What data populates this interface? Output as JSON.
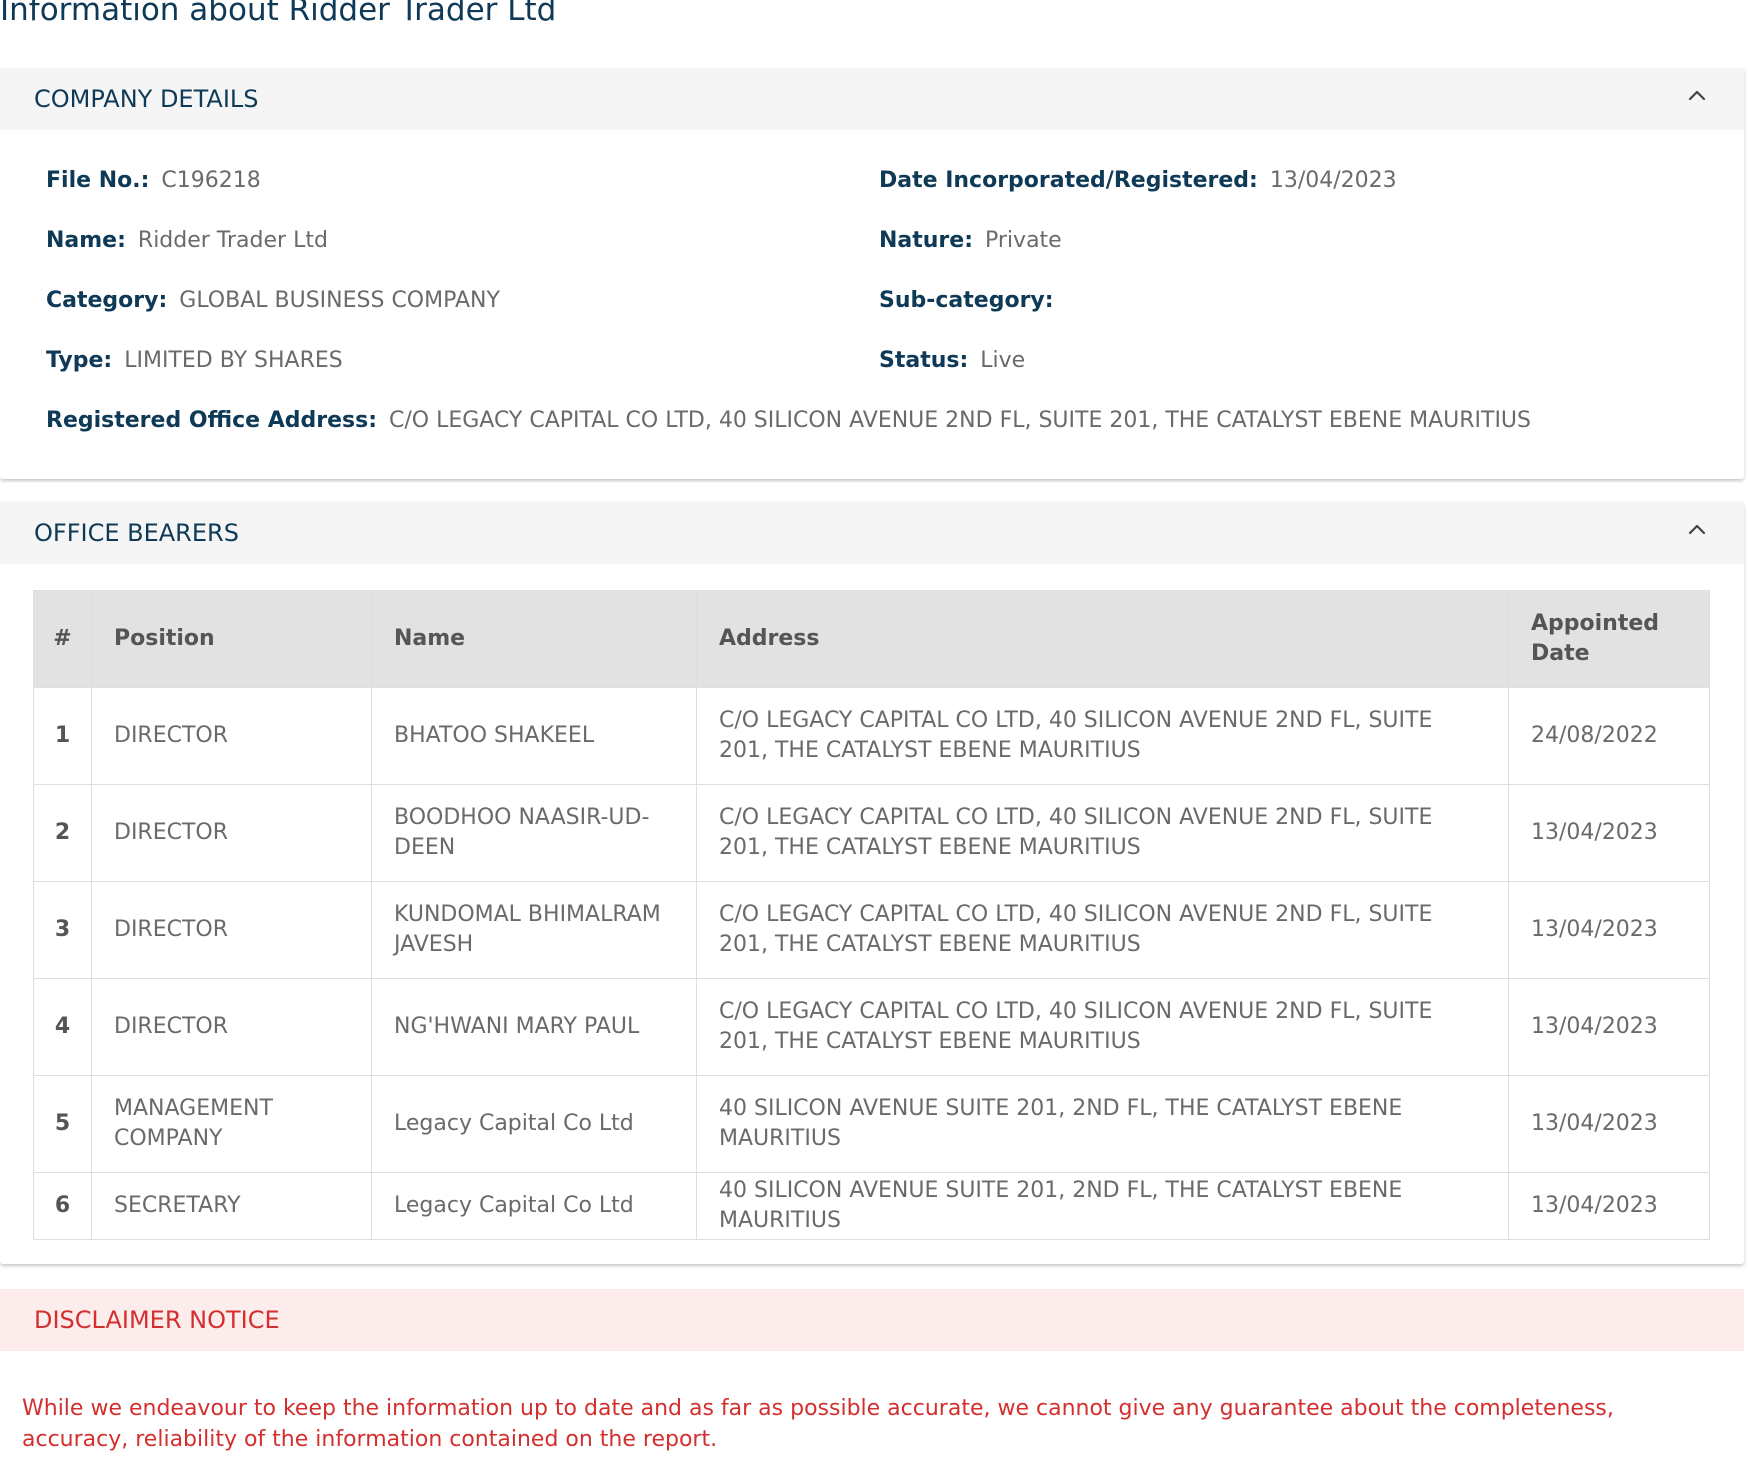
{
  "page": {
    "title": "Information about Ridder Trader Ltd"
  },
  "company_details": {
    "header": "COMPANY DETAILS",
    "collapse_icon": "chevron-up-icon",
    "fields": {
      "file_no": {
        "label": "File No.:",
        "value": "C196218"
      },
      "date_incorporated": {
        "label": "Date Incorporated/Registered:",
        "value": "13/04/2023"
      },
      "name": {
        "label": "Name:",
        "value": "Ridder Trader Ltd"
      },
      "nature": {
        "label": "Nature:",
        "value": "Private"
      },
      "category": {
        "label": "Category:",
        "value": "GLOBAL BUSINESS COMPANY"
      },
      "sub_category": {
        "label": "Sub-category:",
        "value": ""
      },
      "type": {
        "label": "Type:",
        "value": "LIMITED BY SHARES"
      },
      "status": {
        "label": "Status:",
        "value": "Live"
      },
      "registered_office": {
        "label": "Registered Office Address:",
        "value": "C/O LEGACY CAPITAL CO LTD, 40 SILICON AVENUE 2ND FL, SUITE 201, THE CATALYST EBENE MAURITIUS"
      }
    }
  },
  "office_bearers": {
    "header": "OFFICE BEARERS",
    "collapse_icon": "chevron-up-icon",
    "columns": [
      "#",
      "Position",
      "Name",
      "Address",
      "Appointed Date"
    ],
    "rows": [
      {
        "num": "1",
        "position": "DIRECTOR",
        "name": "BHATOO SHAKEEL",
        "address": "C/O LEGACY CAPITAL CO LTD, 40 SILICON AVENUE 2ND FL, SUITE 201, THE CATALYST EBENE MAURITIUS",
        "date": "24/08/2022"
      },
      {
        "num": "2",
        "position": "DIRECTOR",
        "name": "BOODHOO NAASIR-UD-DEEN",
        "address": "C/O LEGACY CAPITAL CO LTD, 40 SILICON AVENUE 2ND FL, SUITE 201, THE CATALYST EBENE MAURITIUS",
        "date": "13/04/2023"
      },
      {
        "num": "3",
        "position": "DIRECTOR",
        "name": "KUNDOMAL BHIMALRAM JAVESH",
        "address": "C/O LEGACY CAPITAL CO LTD, 40 SILICON AVENUE 2ND FL, SUITE 201, THE CATALYST EBENE MAURITIUS",
        "date": "13/04/2023"
      },
      {
        "num": "4",
        "position": "DIRECTOR",
        "name": "NG'HWANI MARY PAUL",
        "address": "C/O LEGACY CAPITAL CO LTD, 40 SILICON AVENUE 2ND FL, SUITE 201, THE CATALYST EBENE MAURITIUS",
        "date": "13/04/2023"
      },
      {
        "num": "5",
        "position": "MANAGEMENT COMPANY",
        "name": "Legacy Capital Co Ltd",
        "address": "40 SILICON AVENUE SUITE 201, 2ND FL, THE CATALYST EBENE MAURITIUS",
        "date": "13/04/2023"
      },
      {
        "num": "6",
        "position": "SECRETARY",
        "name": "Legacy Capital Co Ltd",
        "address": "40 SILICON AVENUE SUITE 201, 2ND FL, THE CATALYST EBENE MAURITIUS",
        "date": "13/04/2023"
      }
    ]
  },
  "disclaimer": {
    "header": "DISCLAIMER NOTICE",
    "text": "While we endeavour to keep the information up to date and as far as possible accurate, we cannot give any guarantee about the completeness, accuracy, reliability of the information contained on the report."
  },
  "colors": {
    "heading": "#0f3a57",
    "body_text": "#6a6a6a",
    "panel_header_bg": "#f5f5f5",
    "table_header_bg": "#e2e2e2",
    "disclaimer_bg": "#fdecec",
    "disclaimer_text": "#d42f2f"
  }
}
